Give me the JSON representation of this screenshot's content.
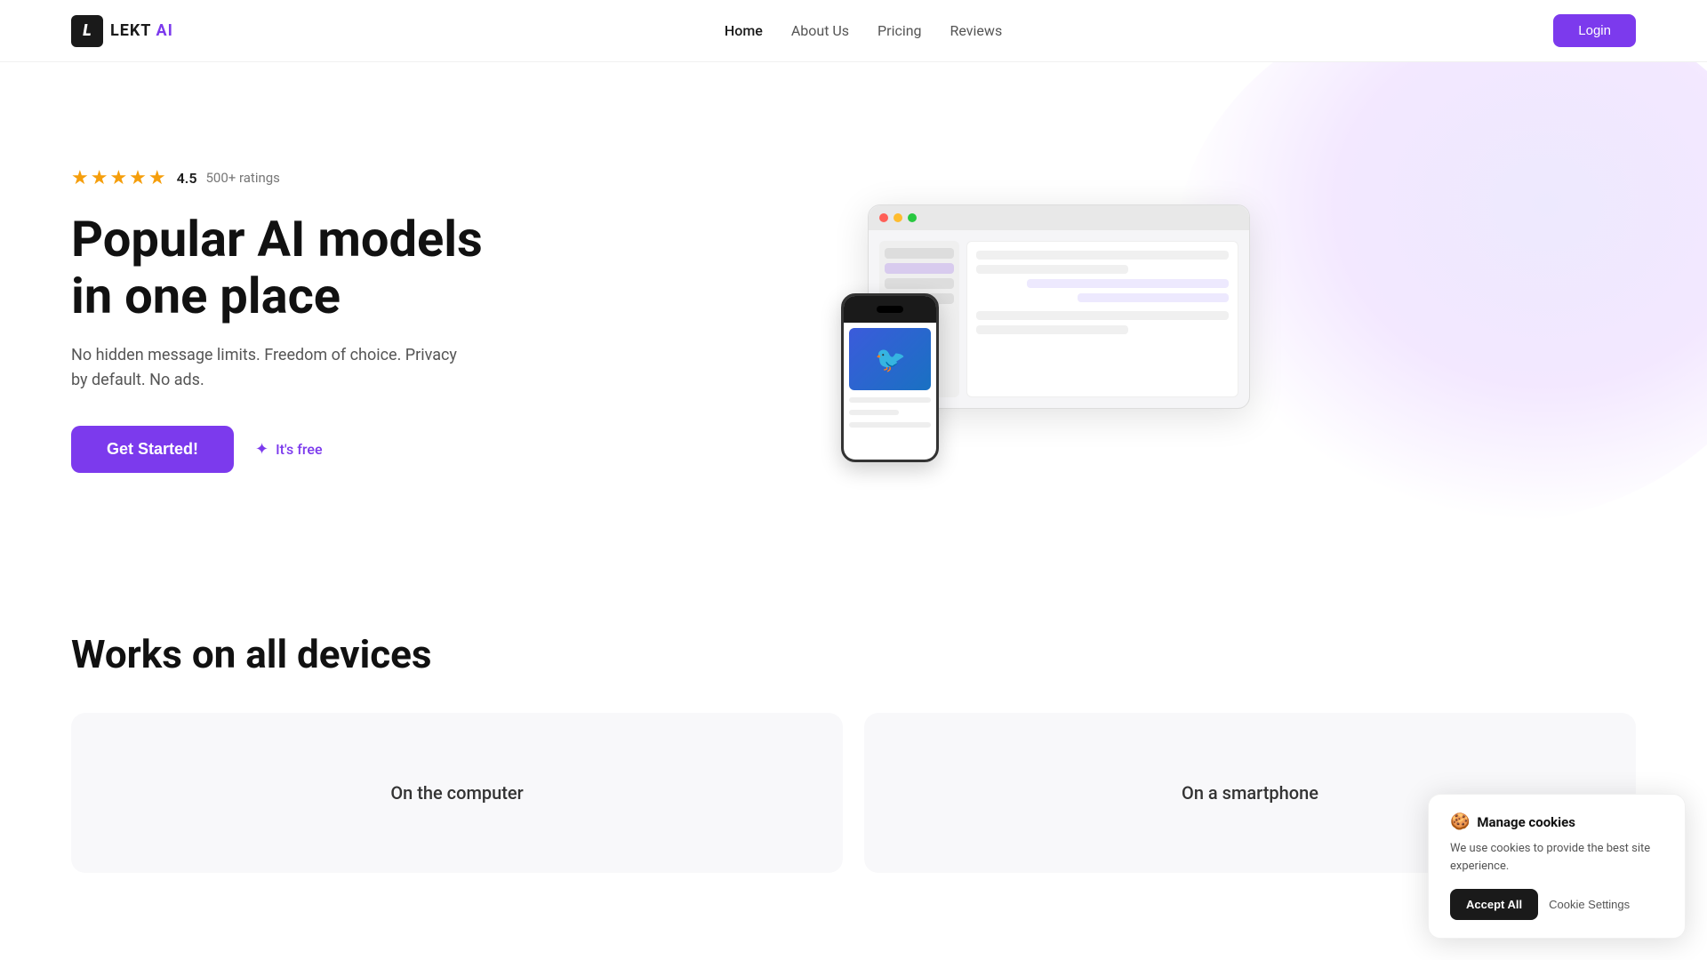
{
  "nav": {
    "logo_letter": "L",
    "logo_name": "LEKT AI",
    "links": [
      {
        "label": "Home",
        "active": true
      },
      {
        "label": "About Us",
        "active": false
      },
      {
        "label": "Pricing",
        "active": false
      },
      {
        "label": "Reviews",
        "active": false
      }
    ],
    "login_label": "Login"
  },
  "hero": {
    "rating_stars": "★★★★½",
    "rating_score": "4.5",
    "rating_count": "500+ ratings",
    "title_line1": "Popular AI models",
    "title_line2": "in one place",
    "subtitle": "No hidden message limits. Freedom of choice. Privacy by default. No ads.",
    "cta_label": "Get Started!",
    "free_label": "It's free",
    "sparkle": "✦"
  },
  "devices_section": {
    "title": "Works on all devices",
    "cards": [
      {
        "label": "On the computer"
      },
      {
        "label": "On a smartphone"
      }
    ]
  },
  "cookie": {
    "emoji": "🍪",
    "title": "Manage cookies",
    "text": "We use cookies to provide the best site experience.",
    "accept_label": "Accept All",
    "settings_label": "Cookie Settings"
  }
}
